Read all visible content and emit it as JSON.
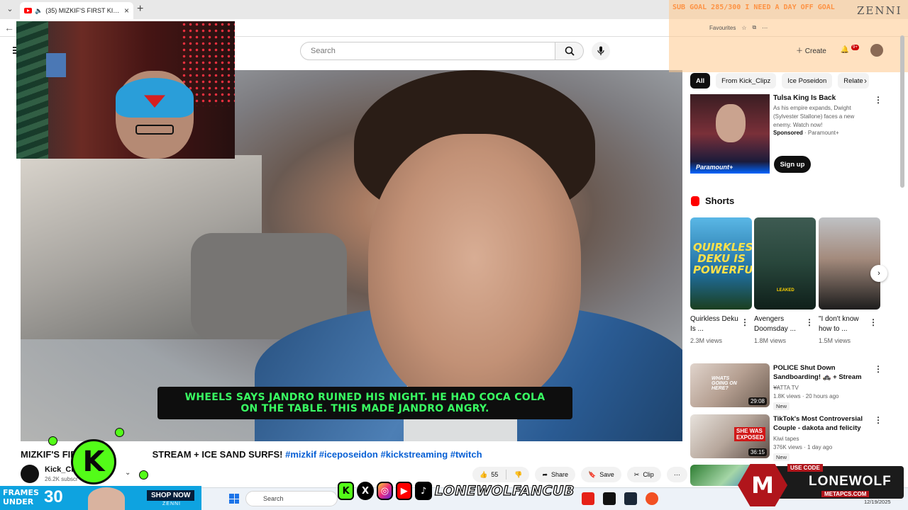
{
  "browser": {
    "tab_title": "(35) MIZKIF'S FIRST KICKSTRE",
    "tab_close": "×",
    "new_tab": "+",
    "favorites_label": "Favourites"
  },
  "youtube": {
    "search_placeholder": "Search",
    "create_label": "Create",
    "notification_count": "9+"
  },
  "overlay": {
    "goal_text": "SUB GOAL 285/300 I NEED A DAY OFF GOAL",
    "brand": "ZENNI"
  },
  "video": {
    "subtitle_line1": "WHEELS SAYS JANDRO RUINED HIS NIGHT. HE HAD COCA COLA",
    "subtitle_line2": "ON THE TABLE. THIS MADE JANDRO ANGRY.",
    "title_part1": "MIZKIF'S FIR",
    "title_part2": "STREAM + ICE SAND SURFS!",
    "hashtags": "#mizkif #iceposeidon #kickstreaming #twitch",
    "channel_name": "Kick_Clip",
    "subscribers": "26.2K subscr",
    "likes": "55",
    "share_label": "Share",
    "save_label": "Save",
    "clip_label": "Clip",
    "kick_logo": "K"
  },
  "chips": [
    "All",
    "From Kick_Clipz",
    "Ice Poseidon",
    "Relate"
  ],
  "ad": {
    "title": "Tulsa King Is Back",
    "description": "As his empire expands, Dwight (Sylvester Stallone) faces a new enemy. Watch now!",
    "sponsored": "Sponsored",
    "advertiser": "Paramount+",
    "cta": "Sign up",
    "logo": "Paramount+"
  },
  "shorts": {
    "heading": "Shorts",
    "items": [
      {
        "title": "Quirkless Deku Is ...",
        "views": "2.3M views",
        "overlay": "QUIRKLESS DEKU IS POWERFUL"
      },
      {
        "title": "Avengers Doomsday ...",
        "views": "1.8M views",
        "overlay": "LEAKED"
      },
      {
        "title": "\"I don't know how to ...",
        "views": "1.5M views",
        "overlay": ""
      }
    ]
  },
  "recommended": [
    {
      "title": "POLICE Shut Down Sandboarding! 🚓 + Stream ...",
      "channel": "YATTA TV",
      "meta": "1.8K views · 20 hours ago",
      "badge": "New",
      "duration": "29:08",
      "thumb_text": "WHATS GOING ON HERE?"
    },
    {
      "title": "TikTok's Most Controversial Couple - dakota and felicity",
      "channel": "Kiwi tapes",
      "meta": "376K views · 1 day ago",
      "badge": "New",
      "duration": "36:15",
      "thumb_text": "SHE WAS EXPOSED"
    }
  ],
  "promo": {
    "frames_line1": "FRAMES",
    "frames_line2": "UNDER",
    "price": "30",
    "shop_now": "SHOP NOW",
    "zenni": "ZENNI",
    "handle": "LONEWOLFANCUB",
    "lonewolf_code_label": "USE CODE",
    "lonewolf_name": "LONEWOLF",
    "lonewolf_site": "METAPCS.COM",
    "lonewolf_logo": "M"
  },
  "taskbar": {
    "search_placeholder": "Search",
    "date": "12/19/2025"
  },
  "colors": {
    "kick_green": "#53fc18",
    "youtube_red": "#ff0000",
    "link_blue": "#065fd4"
  }
}
